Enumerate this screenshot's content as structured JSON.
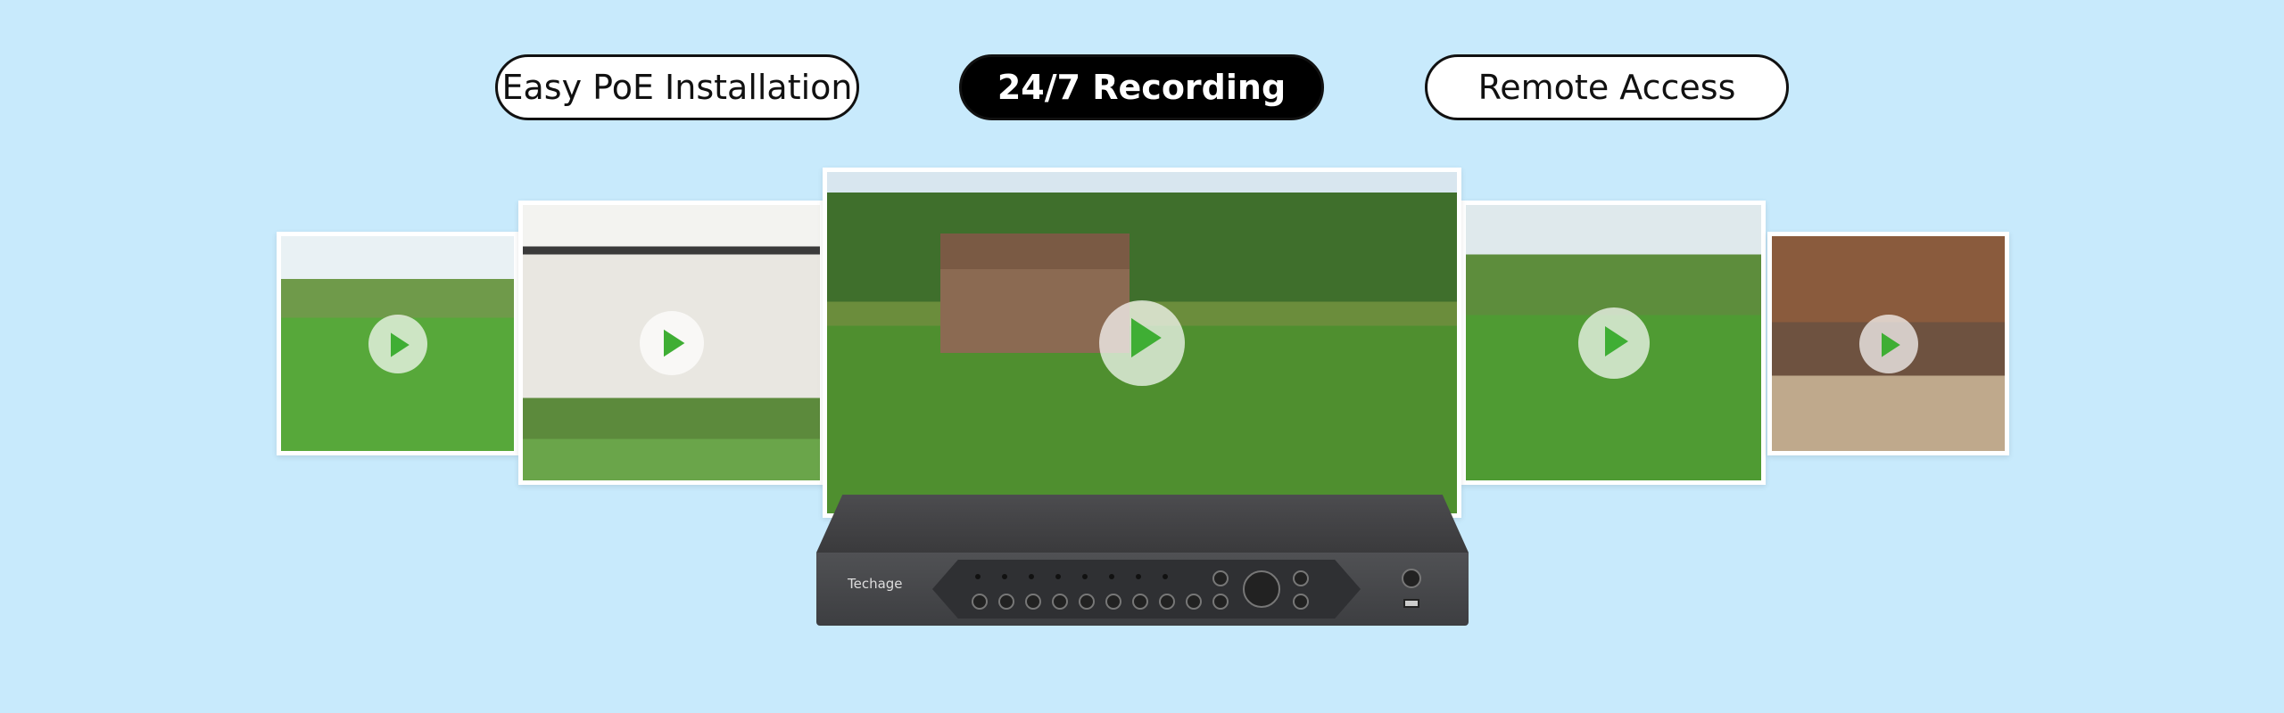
{
  "features": [
    {
      "label": "Easy PoE Installation",
      "active": false
    },
    {
      "label": "24/7 Recording",
      "active": true
    },
    {
      "label": "Remote Access",
      "active": false
    }
  ],
  "device": {
    "brand": "Techage"
  },
  "videos": [
    {
      "icon": "play-icon"
    },
    {
      "icon": "play-icon"
    },
    {
      "icon": "play-icon"
    },
    {
      "icon": "play-icon"
    },
    {
      "icon": "play-icon"
    }
  ],
  "colors": {
    "background": "#c8eafc",
    "play": "#3fae34",
    "active_pill": "#000000"
  }
}
